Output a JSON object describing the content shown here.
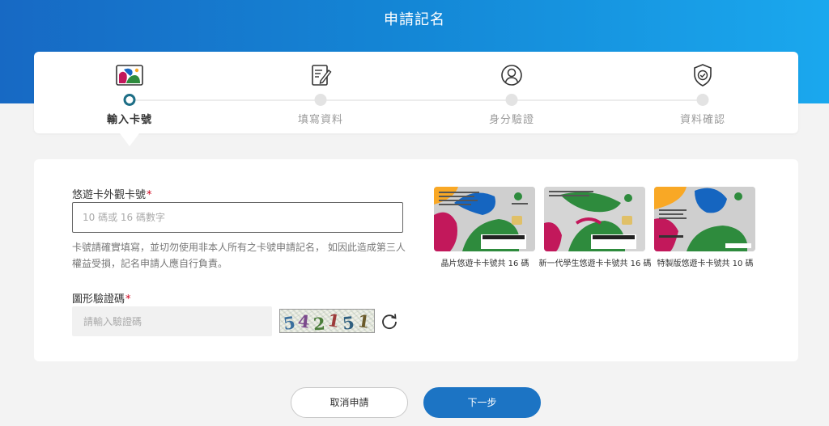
{
  "header": {
    "title": "申請記名"
  },
  "steps": [
    {
      "label": "輸入卡號",
      "icon": "card-icon",
      "active": true
    },
    {
      "label": "填寫資料",
      "icon": "edit-document-icon",
      "active": false
    },
    {
      "label": "身分驗證",
      "icon": "user-circle-icon",
      "active": false
    },
    {
      "label": "資料確認",
      "icon": "shield-check-icon",
      "active": false
    }
  ],
  "form": {
    "card_number": {
      "label": "悠遊卡外觀卡號",
      "required_mark": "*",
      "value": "",
      "placeholder": "10 碼或 16 碼數字",
      "hint": "卡號請確實填寫，並切勿使用非本人所有之卡號申請記名， 如因此造成第三人權益受損，記名申請人應自行負責。"
    },
    "captcha": {
      "label": "圖形驗證碼",
      "required_mark": "*",
      "value": "",
      "placeholder": "請輸入驗證碼",
      "image_text": "542151",
      "refresh_icon": "refresh-icon"
    }
  },
  "samples": [
    {
      "caption": "晶片悠遊卡卡號共 16 碼",
      "card_number": "1203000001234567"
    },
    {
      "caption": "新一代學生悠遊卡卡號共 16 碼",
      "card_number": "1203000001234567"
    },
    {
      "caption": "特製版悠遊卡卡號共 10 碼",
      "card_number": "123 456789 0"
    }
  ],
  "buttons": {
    "cancel": "取消申請",
    "next": "下一步"
  },
  "colors": {
    "header_gradient_start": "#1769c4",
    "header_gradient_end": "#1aa8ee",
    "primary_button": "#1c74c4",
    "active_step": "#1d6e86",
    "required_mark": "#d0021b"
  }
}
